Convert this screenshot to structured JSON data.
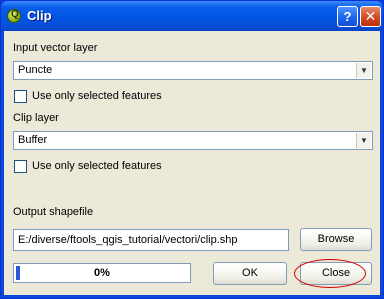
{
  "window": {
    "title": "Clip",
    "app_icon": "qgis-q-icon",
    "help_glyph": "?",
    "close_glyph": "✕"
  },
  "input_layer": {
    "label": "Input vector layer",
    "value": "Puncte",
    "use_selected_label": "Use only selected features",
    "use_selected_checked": false
  },
  "clip_layer": {
    "label": "Clip layer",
    "value": "Buffer",
    "use_selected_label": "Use only selected features",
    "use_selected_checked": false
  },
  "output": {
    "label": "Output shapefile",
    "path": "E:/diverse/ftools_qgis_tutorial/vectori/clip.shp",
    "browse_label": "Browse"
  },
  "progress": {
    "text": "0%",
    "value": 0
  },
  "buttons": {
    "ok_label": "OK",
    "close_label": "Close"
  },
  "annotation": {
    "color": "#d40000",
    "target": "close-button"
  }
}
